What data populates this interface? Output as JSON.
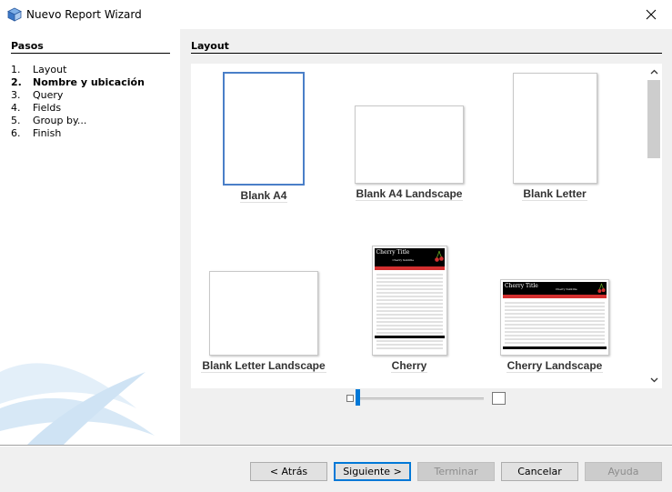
{
  "window": {
    "title": "Nuevo  Report Wizard",
    "icon": "app-cube-icon",
    "close_icon": "close-icon"
  },
  "steps": {
    "header": "Pasos",
    "items": [
      {
        "num": "1.",
        "label": "Layout",
        "current": false
      },
      {
        "num": "2.",
        "label": "Nombre y ubicación",
        "current": true
      },
      {
        "num": "3.",
        "label": "Query",
        "current": false
      },
      {
        "num": "4.",
        "label": "Fields",
        "current": false
      },
      {
        "num": "5.",
        "label": "Group by...",
        "current": false
      },
      {
        "num": "6.",
        "label": "Finish",
        "current": false
      }
    ]
  },
  "main": {
    "header": "Layout",
    "templates": [
      {
        "label": "Blank A4",
        "selected": true
      },
      {
        "label": "Blank A4 Landscape",
        "selected": false
      },
      {
        "label": "Blank Letter",
        "selected": false
      },
      {
        "label": "Blank Letter Landscape",
        "selected": false
      },
      {
        "label": "Cherry",
        "selected": false
      },
      {
        "label": "Cherry Landscape",
        "selected": false
      }
    ],
    "thumb_text": {
      "cherry_title": "Cherry Title",
      "cherry_subtitle": "Cherry Subtitle"
    }
  },
  "zoom": {
    "level": 0.0
  },
  "buttons": {
    "back": "< Atrás",
    "next": "Siguiente >",
    "finish": "Terminar",
    "cancel": "Cancelar",
    "help": "Ayuda"
  },
  "colors": {
    "selection": "#4a7fc8",
    "accent": "#0078d7",
    "cherry_red": "#d32f2f"
  }
}
